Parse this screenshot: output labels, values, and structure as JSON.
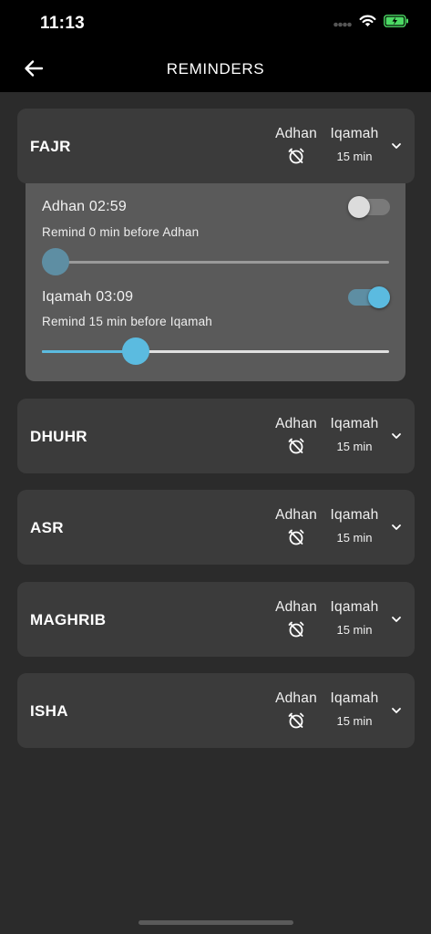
{
  "status_bar": {
    "time": "11:13"
  },
  "header": {
    "title": "REMINDERS",
    "back_icon": "arrow-left-icon"
  },
  "columns": {
    "adhan_label": "Adhan",
    "iqamah_label": "Iqamah"
  },
  "prayers": [
    {
      "name": "FAJR",
      "iqamah_offset": "15 min",
      "expanded": true
    },
    {
      "name": "DHUHR",
      "iqamah_offset": "15 min",
      "expanded": false
    },
    {
      "name": "ASR",
      "iqamah_offset": "15 min",
      "expanded": false
    },
    {
      "name": "MAGHRIB",
      "iqamah_offset": "15 min",
      "expanded": false
    },
    {
      "name": "ISHA",
      "iqamah_offset": "15 min",
      "expanded": false
    }
  ],
  "fajr_details": {
    "adhan": {
      "title": "Adhan 02:59",
      "subtitle": "Remind 0 min before Adhan",
      "enabled": false,
      "slider_fraction": 0.04
    },
    "iqamah": {
      "title": "Iqamah 03:09",
      "subtitle": "Remind 15 min before Iqamah",
      "enabled": true,
      "slider_fraction": 0.27
    }
  },
  "colors": {
    "accent": "#5bbbe0",
    "accent_muted": "#5e8ea3",
    "card": "#3b3b3b",
    "panel": "#5a5a5a",
    "background": "#2b2b2b",
    "battery": "#4cd964"
  }
}
